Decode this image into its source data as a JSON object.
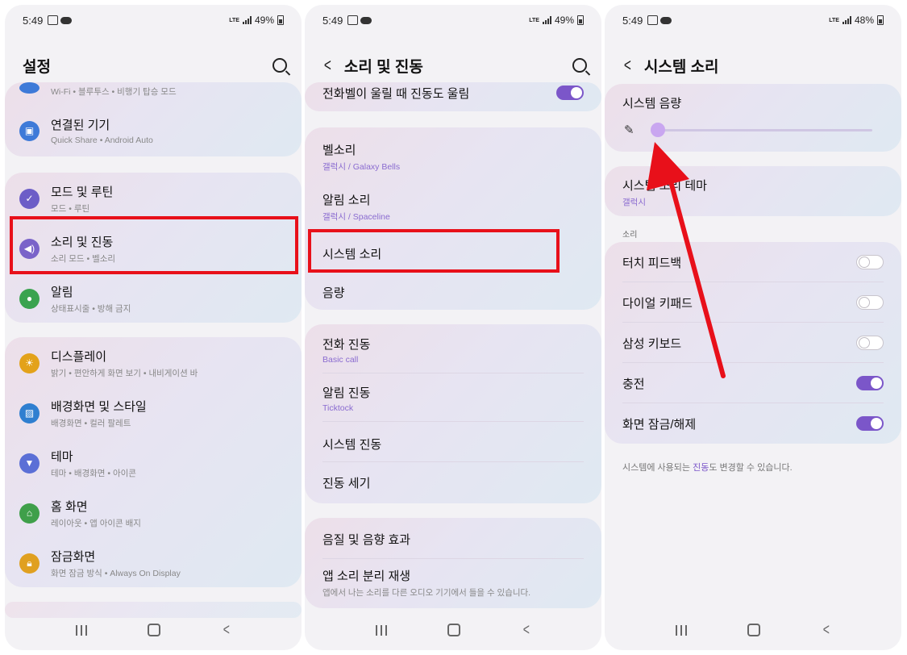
{
  "status": [
    {
      "time": "5:49",
      "net": "LTE",
      "battery": "49%"
    },
    {
      "time": "5:49",
      "net": "LTE",
      "battery": "49%"
    },
    {
      "time": "5:49",
      "net": "LTE",
      "battery": "48%"
    }
  ],
  "p1": {
    "title": "설정",
    "wifi_sub": "Wi-Fi • 블루투스 • 비행기 탑승 모드",
    "items": [
      {
        "label": "연결된 기기",
        "sub": "Quick Share • Android Auto",
        "icon": "devices-icon",
        "color": "#3e7ad8"
      },
      {
        "label": "모드 및 루틴",
        "sub": "모드 • 루틴",
        "icon": "check-circle-icon",
        "color": "#6c5dc7"
      },
      {
        "label": "소리 및 진동",
        "sub": "소리 모드 • 벨소리",
        "icon": "speaker-icon",
        "color": "#7a63c9"
      },
      {
        "label": "알림",
        "sub": "상태표시줄 • 방해 금지",
        "icon": "notification-icon",
        "color": "#3aa34f"
      },
      {
        "label": "디스플레이",
        "sub": "밝기 • 편안하게 화면 보기 • 내비게이션 바",
        "icon": "sun-icon",
        "color": "#e3a21a"
      },
      {
        "label": "배경화면 및 스타일",
        "sub": "배경화면 • 컬러 팔레트",
        "icon": "wallpaper-icon",
        "color": "#2f7fd0"
      },
      {
        "label": "테마",
        "sub": "테마 • 배경화면 • 아이콘",
        "icon": "theme-icon",
        "color": "#5b6fd6"
      },
      {
        "label": "홈 화면",
        "sub": "레이아웃 • 앱 아이콘 배지",
        "icon": "home-icon",
        "color": "#3f9f4a"
      },
      {
        "label": "잠금화면",
        "sub": "화면 잠금 방식 • Always On Display",
        "icon": "lock-icon",
        "color": "#e0a020"
      }
    ]
  },
  "p2": {
    "title": "소리 및 진동",
    "items": [
      {
        "label": "전화벨이 울릴 때 진동도 울림"
      },
      {
        "label": "벨소리",
        "sub": "갤럭시 / Galaxy Bells"
      },
      {
        "label": "알림 소리",
        "sub": "갤럭시 / Spaceline"
      },
      {
        "label": "시스템 소리"
      },
      {
        "label": "음량"
      },
      {
        "label": "전화 진동",
        "sub": "Basic call"
      },
      {
        "label": "알림 진동",
        "sub": "Ticktock"
      },
      {
        "label": "시스템 진동"
      },
      {
        "label": "진동 세기"
      },
      {
        "label": "음질 및 음향 효과"
      },
      {
        "label": "앱 소리 분리 재생",
        "sub": "앱에서 나는 소리를 다른 오디오 기기에서 들을 수 있습니다."
      }
    ],
    "vibrate_with_ring": true
  },
  "p3": {
    "title": "시스템 소리",
    "volume_label": "시스템 음량",
    "volume_level": 0.0,
    "theme_label": "시스템 소리 테마",
    "theme_sub": "갤럭시",
    "section": "소리",
    "toggles": [
      {
        "label": "터치 피드백",
        "on": false
      },
      {
        "label": "다이얼 키패드",
        "on": false
      },
      {
        "label": "삼성 키보드",
        "on": false
      },
      {
        "label": "충전",
        "on": true
      },
      {
        "label": "화면 잠금/해제",
        "on": true
      }
    ],
    "foot_before": "시스템에 사용되는 ",
    "foot_link": "진동",
    "foot_after": "도 변경할 수 있습니다."
  },
  "colors": {
    "accent": "#7b56c9",
    "highlight": "#e8101a"
  }
}
